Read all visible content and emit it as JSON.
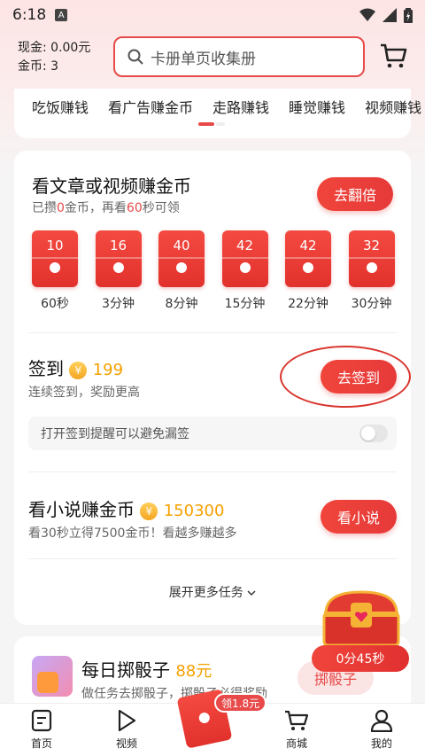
{
  "status": {
    "time": "6:18",
    "a_icon": "A"
  },
  "header": {
    "cash_label": "现金: 0.00元",
    "coin_label": "金币: 3",
    "search_placeholder": "卡册单页收集册"
  },
  "tabs": [
    "吃饭赚钱",
    "看广告赚金币",
    "走路赚钱",
    "睡觉赚钱",
    "视频赚钱"
  ],
  "video_task": {
    "title": "看文章或视频赚金币",
    "sub_prefix": "已攒",
    "sub_count": "0",
    "sub_mid": "金币，再看",
    "sub_secs": "60",
    "sub_suffix": "秒可领",
    "button": "去翻倍",
    "envelopes": [
      {
        "amount": "10",
        "label": "60秒"
      },
      {
        "amount": "16",
        "label": "3分钟"
      },
      {
        "amount": "40",
        "label": "8分钟"
      },
      {
        "amount": "42",
        "label": "15分钟"
      },
      {
        "amount": "42",
        "label": "22分钟"
      },
      {
        "amount": "32",
        "label": "30分钟"
      }
    ]
  },
  "signin": {
    "title": "签到",
    "reward": "199",
    "sub": "连续签到，奖励更高",
    "button": "去签到",
    "remind": "打开签到提醒可以避免漏签",
    "remind_on": false
  },
  "novel": {
    "title": "看小说赚金币",
    "reward": "150300",
    "sub": "看30秒立得7500金币！看越多赚越多",
    "button": "看小说"
  },
  "expand_label": "展开更多任务",
  "dice": {
    "title": "每日掷骰子",
    "reward": "88元",
    "sub": "做任务去掷骰子，掷骰子必得奖励",
    "button": "掷骰子"
  },
  "chest": {
    "timer": "0分45秒"
  },
  "nav": {
    "home": "首页",
    "video": "视频",
    "badge": "领1.8元",
    "mall": "商城",
    "mine": "我的"
  },
  "colors": {
    "accent": "#e84a4a",
    "gold": "#f5a000"
  }
}
